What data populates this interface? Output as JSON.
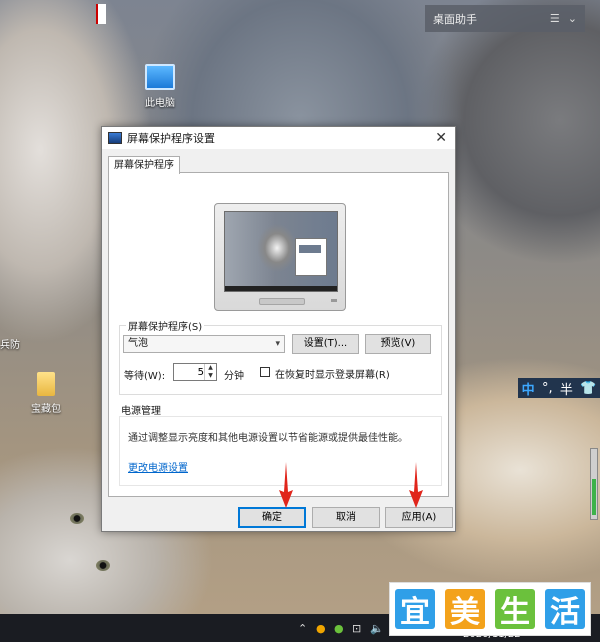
{
  "desktop": {
    "assistant_title": "桌面助手",
    "assistant_menu_icon": "hamburger-icon",
    "assistant_collapse_icon": "chevron-down-icon",
    "icons": [
      {
        "label": "此电脑",
        "icon": "computer-icon"
      },
      {
        "label": "宝藏包",
        "icon": "folder-icon"
      }
    ],
    "edge_label": "兵防"
  },
  "dialog": {
    "title": "屏幕保护程序设置",
    "close_icon": "close-icon",
    "tab_label": "屏幕保护程序",
    "screensaver_group_label": "屏幕保护程序(S)",
    "screensaver_selected": "气泡",
    "settings_button": "设置(T)...",
    "preview_button": "预览(V)",
    "wait_label": "等待(W):",
    "wait_value": "5",
    "wait_unit": "分钟",
    "resume_checkbox_label": "在恢复时显示登录屏幕(R)",
    "resume_checked": false,
    "power_group_label": "电源管理",
    "power_description": "通过调整显示亮度和其他电源设置以节省能源或提供最佳性能。",
    "power_link": "更改电源设置",
    "ok_button": "确定",
    "cancel_button": "取消",
    "apply_button": "应用(A)"
  },
  "ime": {
    "mode": "中",
    "punctuation": "°,",
    "width": "半",
    "skin_icon": "shirt-icon"
  },
  "taskbar": {
    "date": "2020/11/22"
  },
  "watermark": {
    "chars": [
      "宜",
      "美",
      "生",
      "活"
    ],
    "colors": [
      "#2f9fe8",
      "#f3a21b",
      "#6bc13c",
      "#2f9fe8"
    ]
  },
  "colors": {
    "accent": "#0078d7",
    "link": "#0066cc",
    "arrow": "#e0251b"
  }
}
